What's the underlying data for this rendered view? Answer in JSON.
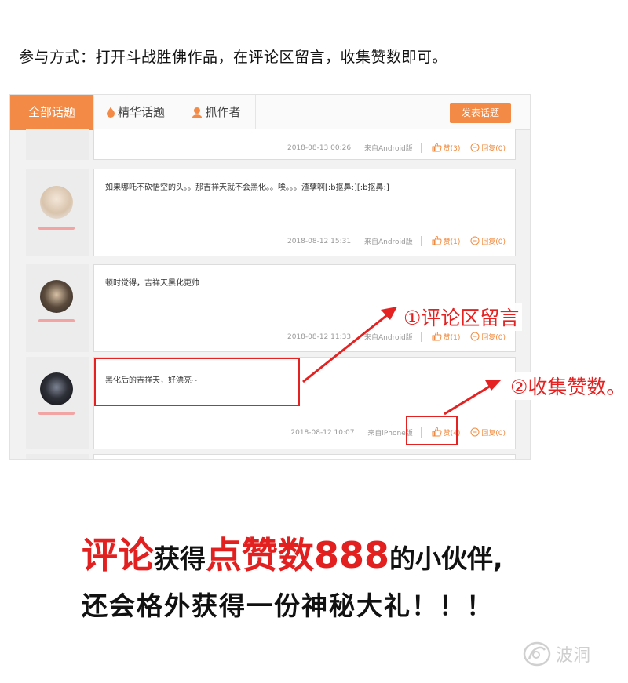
{
  "instruction": "参与方式：打开斗战胜佛作品，在评论区留言，收集赞数即可。",
  "tabs": [
    {
      "label": "全部话题",
      "icon": ""
    },
    {
      "label": "精华话题",
      "icon": "flame-icon"
    },
    {
      "label": "抓作者",
      "icon": "person-icon"
    }
  ],
  "post_button": "发表话题",
  "comments": [
    {
      "text": "",
      "time": "2018-08-13 00:26",
      "source": "来自Android版",
      "like": "赞(3)",
      "reply": "回复(0)"
    },
    {
      "text": "如果哪吒不砍悟空的头。。那吉祥天就不会黑化。。唉。。。渣孽啊[:b抠鼻:][:b抠鼻:]",
      "time": "2018-08-12 15:31",
      "source": "来自Android版",
      "like": "赞(1)",
      "reply": "回复(0)"
    },
    {
      "text": "顿时觉得，吉祥天黑化更帅",
      "time": "2018-08-12 11:33",
      "source": "来自Android版",
      "like": "赞(1)",
      "reply": "回复(0)"
    },
    {
      "text": "黑化后的吉祥天，好漂亮~",
      "time": "2018-08-12 10:07",
      "source": "来自iPhone版",
      "like": "赞(4)",
      "reply": "回复(0)"
    }
  ],
  "annotations": {
    "step1": "①评论区留言",
    "step2": "②收集赞数。"
  },
  "promo": {
    "part1": "评论",
    "part2": "获得",
    "part3": "点赞数888",
    "part4": "的小伙伴,",
    "line2": "还会格外获得一份神秘大礼！！！"
  },
  "watermark": "波洞",
  "colors": {
    "accent": "#f38a45",
    "annotation_red": "#e42222"
  }
}
